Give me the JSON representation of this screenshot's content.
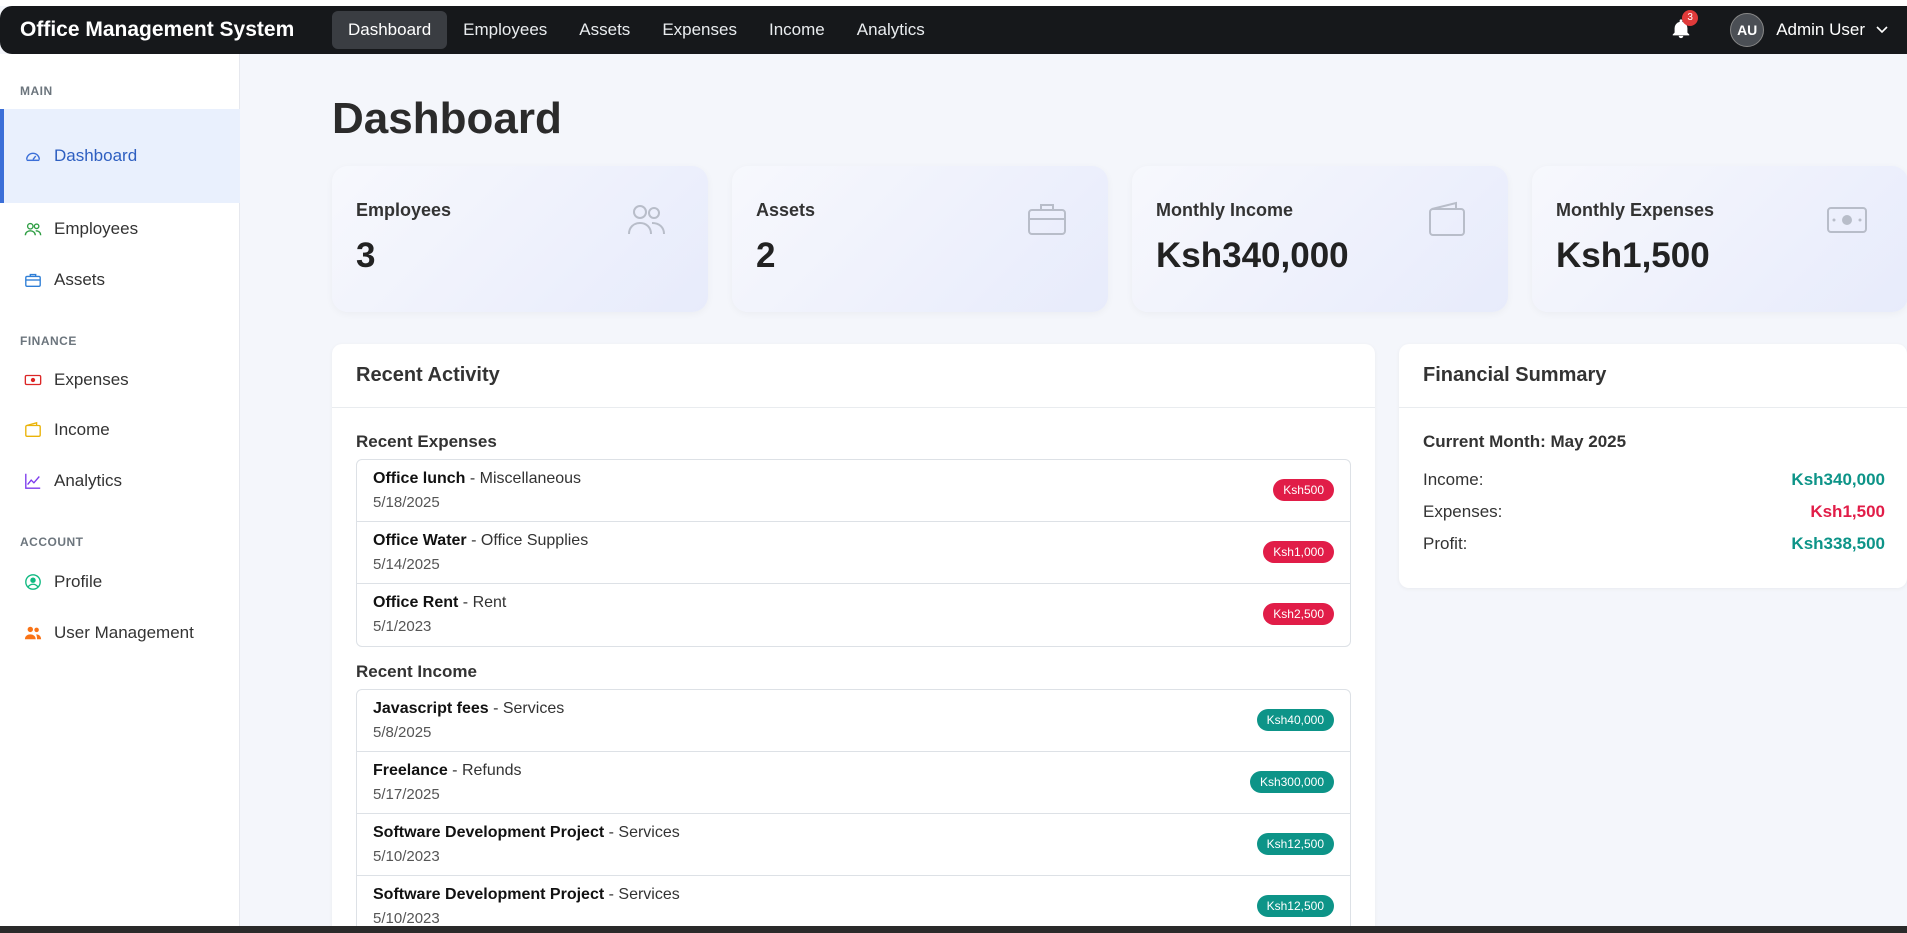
{
  "app": {
    "title": "Office Management System"
  },
  "nav": {
    "links": [
      {
        "label": "Dashboard"
      },
      {
        "label": "Employees"
      },
      {
        "label": "Assets"
      },
      {
        "label": "Expenses"
      },
      {
        "label": "Income"
      },
      {
        "label": "Analytics"
      }
    ],
    "active": "Dashboard",
    "notification_count": "3",
    "user_initials": "AU",
    "user_name": "Admin User"
  },
  "sidebar": {
    "sections": {
      "main": "MAIN",
      "finance": "FINANCE",
      "account": "ACCOUNT"
    },
    "items": [
      {
        "label": "Dashboard",
        "icon": "speedometer-icon"
      },
      {
        "label": "Employees",
        "icon": "people-icon"
      },
      {
        "label": "Assets",
        "icon": "briefcase-icon"
      },
      {
        "label": "Expenses",
        "icon": "cash-icon"
      },
      {
        "label": "Income",
        "icon": "wallet-icon"
      },
      {
        "label": "Analytics",
        "icon": "chart-line-icon"
      },
      {
        "label": "Profile",
        "icon": "person-circle-icon"
      },
      {
        "label": "User Management",
        "icon": "people-fill-icon"
      }
    ]
  },
  "page": {
    "title": "Dashboard"
  },
  "stats": [
    {
      "label": "Employees",
      "value": "3",
      "icon": "people-icon"
    },
    {
      "label": "Assets",
      "value": "2",
      "icon": "briefcase-icon"
    },
    {
      "label": "Monthly Income",
      "value": "Ksh340,000",
      "icon": "wallet-icon"
    },
    {
      "label": "Monthly Expenses",
      "value": "Ksh1,500",
      "icon": "cash-icon"
    }
  ],
  "recent_activity": {
    "title": "Recent Activity",
    "expenses_title": "Recent Expenses",
    "expenses": [
      {
        "name": "Office lunch",
        "category": "Miscellaneous",
        "date": "5/18/2025",
        "amount": "Ksh500"
      },
      {
        "name": "Office Water",
        "category": "Office Supplies",
        "date": "5/14/2025",
        "amount": "Ksh1,000"
      },
      {
        "name": "Office Rent",
        "category": "Rent",
        "date": "5/1/2023",
        "amount": "Ksh2,500"
      }
    ],
    "income_title": "Recent Income",
    "income": [
      {
        "name": "Javascript fees",
        "category": "Services",
        "date": "5/8/2025",
        "amount": "Ksh40,000"
      },
      {
        "name": "Freelance",
        "category": "Refunds",
        "date": "5/17/2025",
        "amount": "Ksh300,000"
      },
      {
        "name": "Software Development Project",
        "category": "Services",
        "date": "5/10/2023",
        "amount": "Ksh12,500"
      },
      {
        "name": "Software Development Project",
        "category": "Services",
        "date": "5/10/2023",
        "amount": "Ksh12,500"
      }
    ]
  },
  "financial_summary": {
    "title": "Financial Summary",
    "period": "Current Month: May 2025",
    "income_label": "Income:",
    "income_value": "Ksh340,000",
    "expenses_label": "Expenses:",
    "expenses_value": "Ksh1,500",
    "profit_label": "Profit:",
    "profit_value": "Ksh338,500"
  },
  "colors": {
    "expense": "#e11d48",
    "income": "#0d9488",
    "accent": "#3b6fd8"
  }
}
